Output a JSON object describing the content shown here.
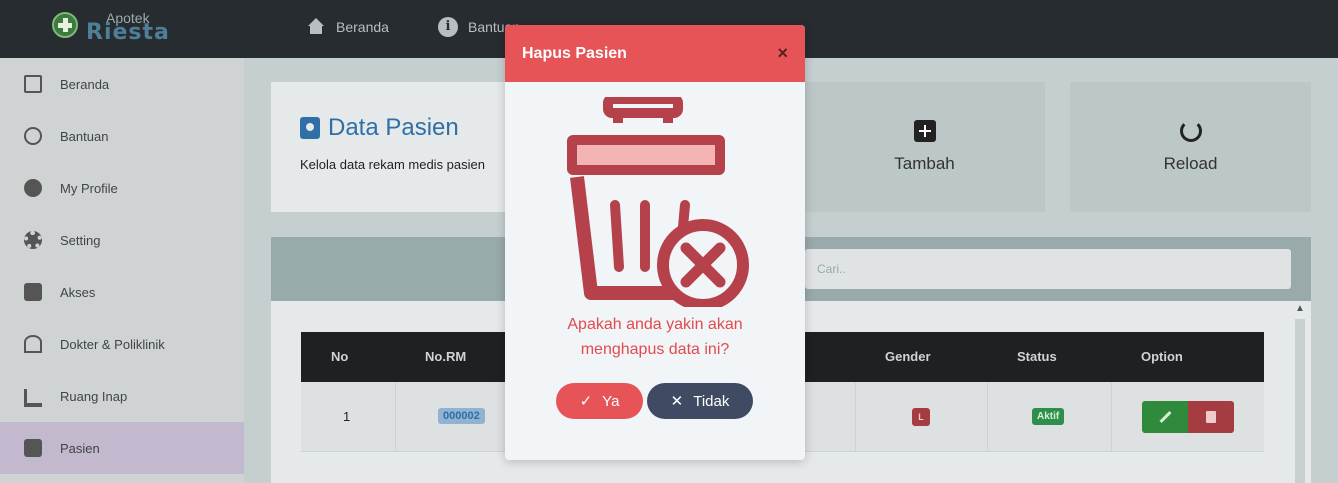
{
  "brand": {
    "small": "Apotek",
    "big": "Riesta"
  },
  "topnav": [
    {
      "label": "Beranda",
      "icon": "home-icon"
    },
    {
      "label": "Bantuan",
      "icon": "info-icon"
    }
  ],
  "sidebar": {
    "items": [
      {
        "label": "Beranda",
        "icon": "monitor-icon"
      },
      {
        "label": "Bantuan",
        "icon": "info-icon"
      },
      {
        "label": "My Profile",
        "icon": "user-circle-icon"
      },
      {
        "label": "Setting",
        "icon": "gear-icon"
      },
      {
        "label": "Akses",
        "icon": "id-card-icon"
      },
      {
        "label": "Dokter & Poliklinik",
        "icon": "hospital-icon"
      },
      {
        "label": "Ruang Inap",
        "icon": "bed-icon"
      },
      {
        "label": "Pasien",
        "icon": "patient-icon",
        "active": true
      }
    ]
  },
  "page": {
    "title": "Data Pasien",
    "subtitle": "Kelola data rekam medis pasien"
  },
  "tiles": {
    "add": "Tambah",
    "reload": "Reload"
  },
  "search": {
    "placeholder": "Cari.."
  },
  "table": {
    "columns": [
      "No",
      "No.RM",
      "Gender",
      "Status",
      "Option"
    ],
    "rows": [
      {
        "no": "1",
        "rm": "000002",
        "gender": "L",
        "status": "Aktif"
      }
    ]
  },
  "modal": {
    "title": "Hapus Pasien",
    "close": "×",
    "message_line1": "Apakah anda yakin akan",
    "message_line2": "menghapus data ini?",
    "yes": "Ya",
    "no": "Tidak",
    "yes_icon": "✓",
    "no_icon": "✕"
  },
  "colors": {
    "accent": "#e65457",
    "dark_button": "#404a63",
    "illustration": "#b5414b",
    "illustration_light": "#f4b4b3"
  }
}
